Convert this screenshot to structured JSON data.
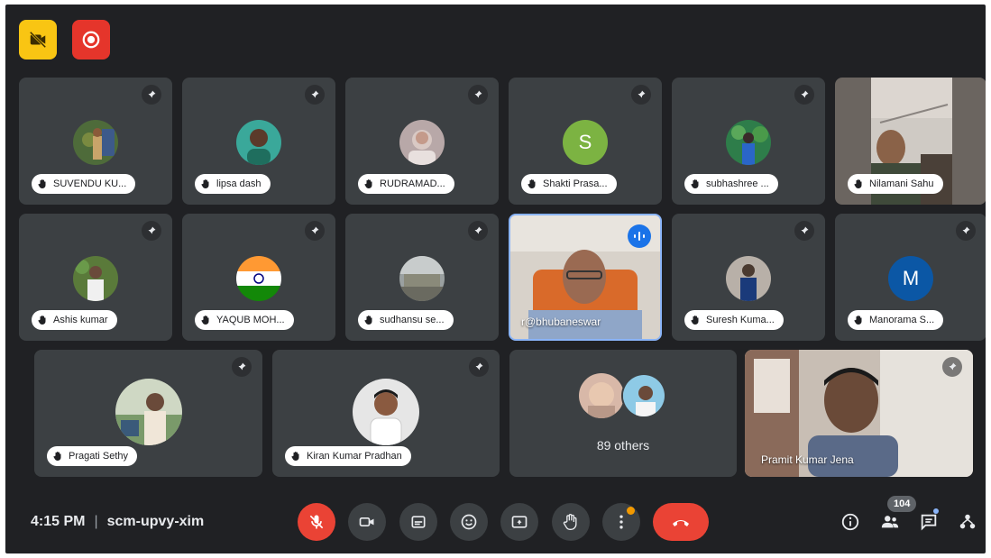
{
  "meeting": {
    "time": "4:15 PM",
    "separator": "|",
    "code": "scm-upvy-xim",
    "people_count": "104"
  },
  "participants": {
    "r1c1": "SUVENDU KU...",
    "r1c2": "lipsa dash",
    "r1c3": "RUDRAMAD...",
    "r1c4": "Shakti Prasa...",
    "r1c4_initial": "S",
    "r1c5": "subhashree ...",
    "r1c6": "Nilamani Sahu",
    "r2c1": "Ashis kumar",
    "r2c2": "YAQUB MOH...",
    "r2c3": "sudhansu se...",
    "r2c4": "r@bhubaneswar",
    "r2c5": "Suresh Kuma...",
    "r2c6": "Manorama S...",
    "r2c6_initial": "M",
    "r3c1": "Pragati Sethy",
    "r3c2": "Kiran Kumar Pradhan",
    "r3c4": "Pramit Kumar Jena",
    "others": "89 others"
  },
  "colors": {
    "background": "#202124",
    "tile": "#3c4043",
    "accent_red": "#ea4335",
    "accent_yellow": "#f9c513",
    "speaking_blue": "#1a73e8",
    "avatar_green": "#7cb342",
    "avatar_navy": "#0b57a5"
  },
  "icons": {
    "top_left_1": "no-camera-icon",
    "top_left_2": "recording-icon",
    "tile_corner": "pin-icon",
    "name_prefix": "raised-hand-icon",
    "controls": [
      "mic-off-icon",
      "camera-icon",
      "captions-icon",
      "emoji-icon",
      "present-icon",
      "raise-hand-icon",
      "more-options-icon",
      "end-call-icon"
    ],
    "right": [
      "info-icon",
      "people-icon",
      "chat-icon",
      "activities-icon"
    ]
  }
}
